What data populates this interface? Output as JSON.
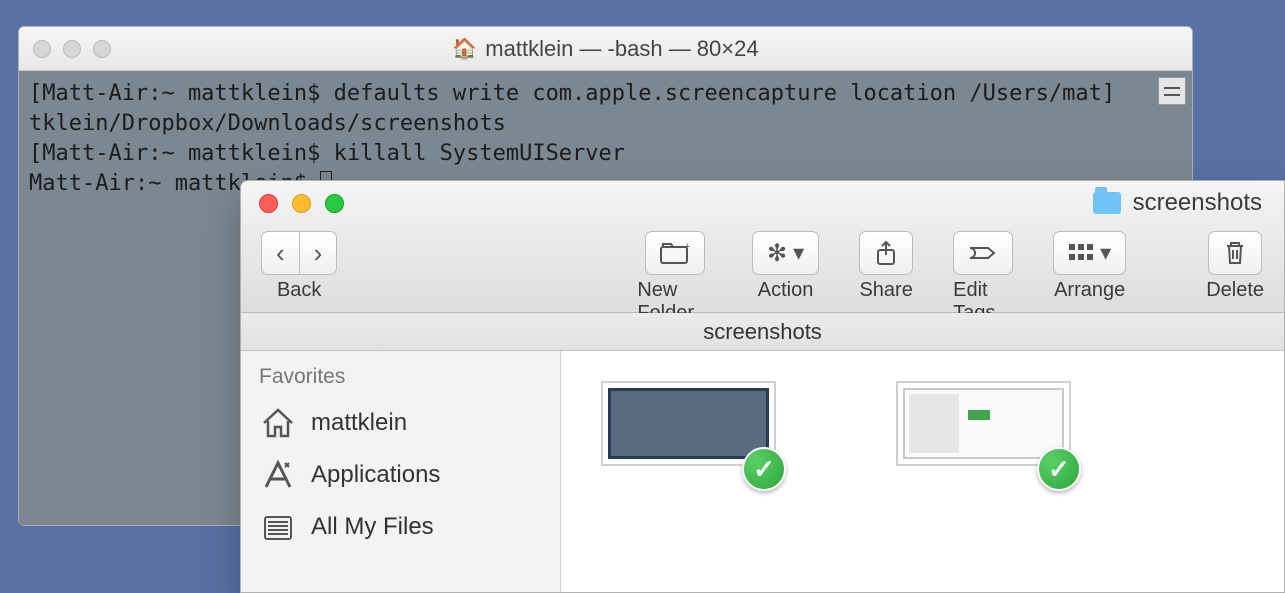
{
  "terminal": {
    "title": "mattklein — -bash — 80×24",
    "prompt": "[Matt-Air:~ mattklein$ ",
    "line1_cmd": "defaults write com.apple.screencapture location /Users/mat]",
    "line1_wrap": "tklein/Dropbox/Downloads/screenshots",
    "line2_prompt": "[Matt-Air:~ mattklein$ ",
    "line2_cmd": "killall SystemUIServer",
    "line3_prompt": "Matt-Air:~ mattklein$ "
  },
  "finder": {
    "title": "screenshots",
    "toolbar": {
      "back": "Back",
      "newfolder": "New Folder",
      "action": "Action",
      "share": "Share",
      "edittags": "Edit Tags",
      "arrange": "Arrange",
      "delete": "Delete"
    },
    "pathbar": "screenshots",
    "sidebar": {
      "header": "Favorites",
      "items": [
        {
          "label": "mattklein"
        },
        {
          "label": "Applications"
        },
        {
          "label": "All My Files"
        }
      ]
    }
  }
}
